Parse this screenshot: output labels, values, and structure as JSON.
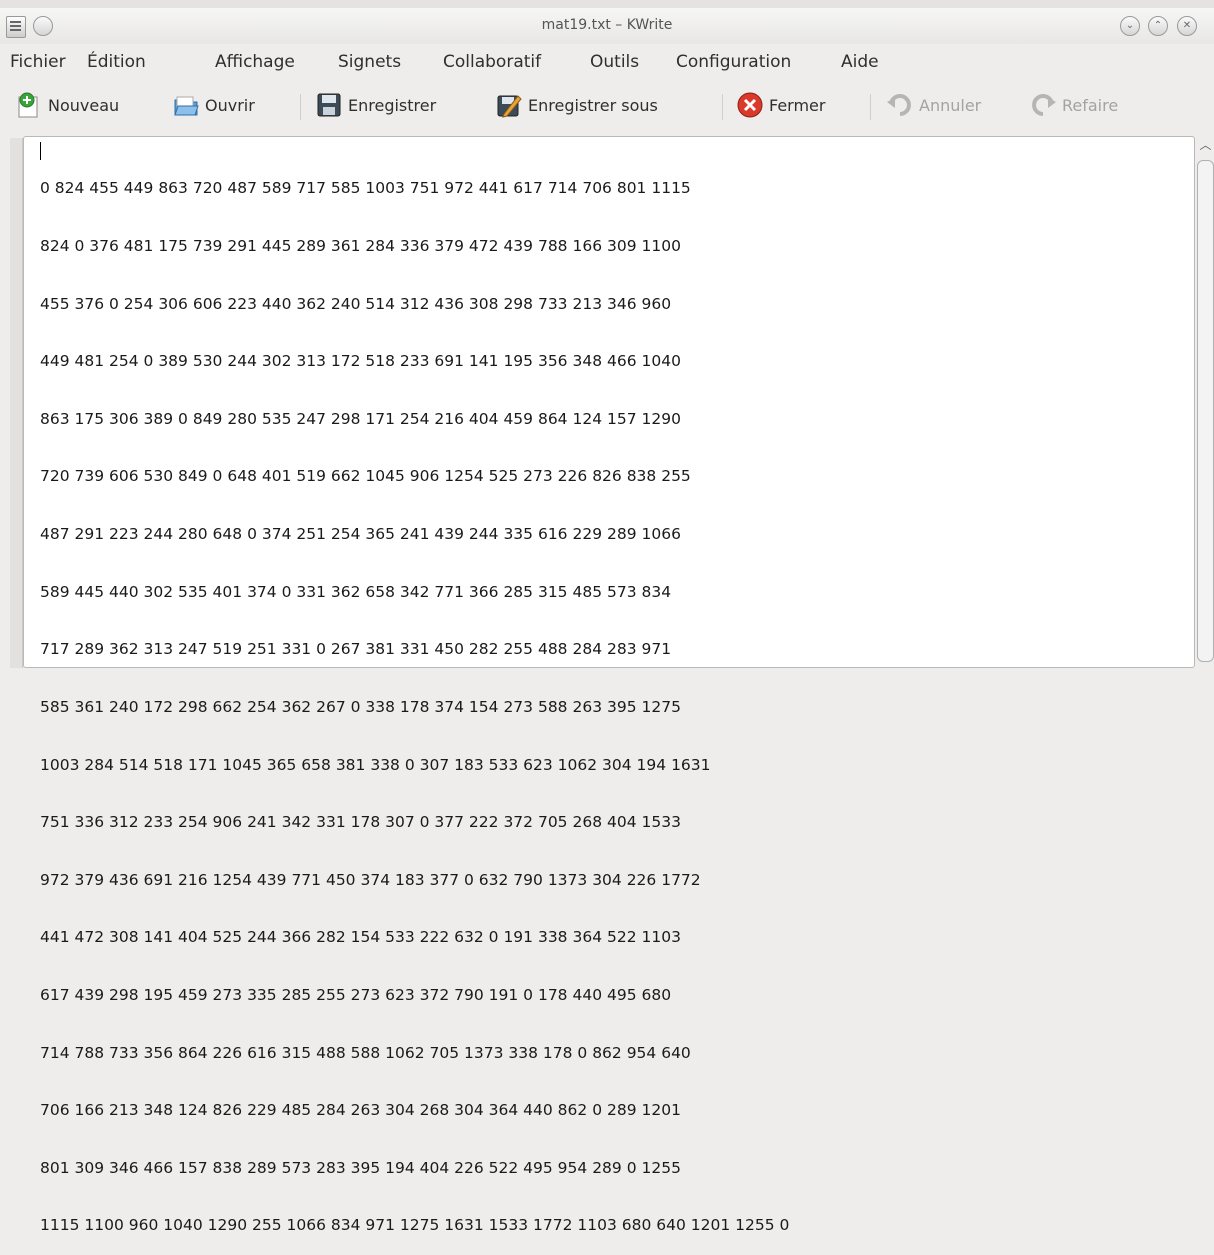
{
  "window": {
    "title": "mat19.txt – KWrite"
  },
  "menu": {
    "items": [
      "Fichier",
      "Édition",
      "Affichage",
      "Signets",
      "Collaboratif",
      "Outils",
      "Configuration",
      "Aide"
    ]
  },
  "toolbar": {
    "new_label": "Nouveau",
    "open_label": "Ouvrir",
    "save_label": "Enregistrer",
    "save_as_label": "Enregistrer sous",
    "close_label": "Fermer",
    "undo_label": "Annuler",
    "redo_label": "Refaire"
  },
  "editor": {
    "lines": [
      "0 824 455 449 863 720 487 589 717 585 1003 751 972 441 617 714 706 801 1115",
      "824 0 376 481 175 739 291 445 289 361 284 336 379 472 439 788 166 309 1100",
      "455 376 0 254 306 606 223 440 362 240 514 312 436 308 298 733 213 346 960",
      "449 481 254 0 389 530 244 302 313 172 518 233 691 141 195 356 348 466 1040",
      "863 175 306 389 0 849 280 535 247 298 171 254 216 404 459 864 124 157 1290",
      "720 739 606 530 849 0 648 401 519 662 1045 906 1254 525 273 226 826 838 255",
      "487 291 223 244 280 648 0 374 251 254 365 241 439 244 335 616 229 289 1066",
      "589 445 440 302 535 401 374 0 331 362 658 342 771 366 285 315 485 573 834",
      "717 289 362 313 247 519 251 331 0 267 381 331 450 282 255 488 284 283 971",
      "585 361 240 172 298 662 254 362 267 0 338 178 374 154 273 588 263 395 1275",
      "1003 284 514 518 171 1045 365 658 381 338 0 307 183 533 623 1062 304 194 1631",
      "751 336 312 233 254 906 241 342 331 178 307 0 377 222 372 705 268 404 1533",
      "972 379 436 691 216 1254 439 771 450 374 183 377 0 632 790 1373 304 226 1772",
      "441 472 308 141 404 525 244 366 282 154 533 222 632 0 191 338 364 522 1103",
      "617 439 298 195 459 273 335 285 255 273 623 372 790 191 0 178 440 495 680",
      "714 788 733 356 864 226 616 315 488 588 1062 705 1373 338 178 0 862 954 640",
      "706 166 213 348 124 826 229 485 284 263 304 268 304 364 440 862 0 289 1201",
      "801 309 346 466 157 838 289 573 283 395 194 404 226 522 495 954 289 0 1255",
      "1115 1100 960 1040 1290 255 1066 834 971 1275 1631 1533 1772 1103 680 640 1201 1255 0"
    ]
  },
  "colors": {
    "window_bg": "#eeedec",
    "editor_bg": "#ffffff",
    "close_red": "#d93a2b",
    "new_green": "#3aa33a"
  }
}
